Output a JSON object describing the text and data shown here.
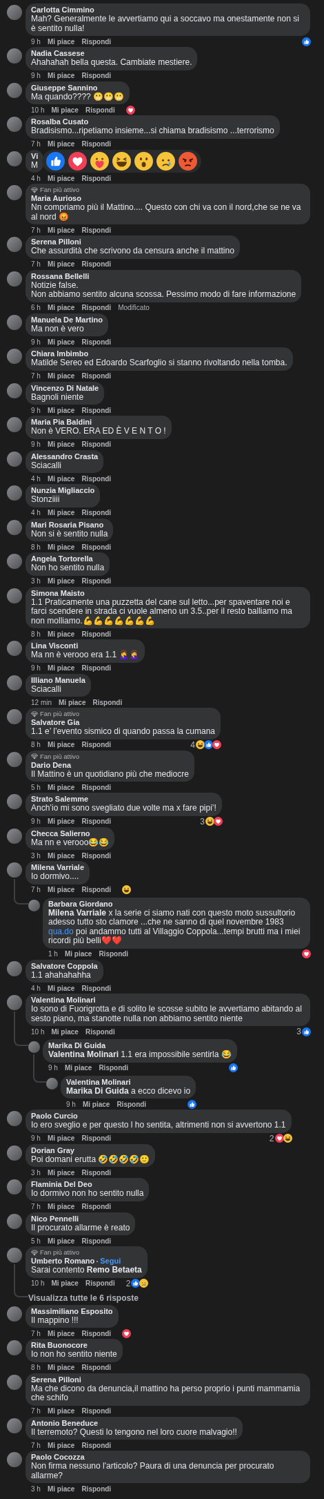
{
  "comments": [
    {
      "author": "Carlotta Cimmino",
      "text": "Mah? Generalmente le avvertiamo qui a soccavo ma onestamente non si è sentito nulla!",
      "time": "9 h",
      "like": "Mi piace",
      "reply": "Rispondi",
      "reactions": {
        "icons": [
          {
            "kind": "like"
          }
        ]
      }
    },
    {
      "author": "Nadia Cassese",
      "text": "Ahahahah bella questa. Cambiate mestiere.",
      "time": "9 h",
      "like": "Mi piace",
      "reply": "Rispondi"
    },
    {
      "author": "Giuseppe Sannino",
      "text": "Ma quando???? 😬😬😬",
      "time": "10 h",
      "like": "Mi piace",
      "reply": "Rispondi",
      "reactions": {
        "icons": [
          {
            "kind": "love"
          }
        ]
      }
    },
    {
      "author": "Rosalba Cusato",
      "text": "Bradisismo...ripetiamo insieme...si chiama bradisismo ...terrorismo",
      "time": "7 h",
      "like": "Mi piace",
      "reply": "Rispondi"
    },
    {
      "author": "Vi",
      "text": "M",
      "time": "4 h",
      "like": "Mi piace",
      "reply": "Rispondi",
      "reaction_picker": [
        {
          "kind": "like"
        },
        {
          "kind": "love"
        },
        {
          "kind": "care"
        },
        {
          "kind": "haha"
        },
        {
          "kind": "wow"
        },
        {
          "kind": "sad"
        },
        {
          "kind": "angry"
        }
      ]
    },
    {
      "badge": "Fan più attivo",
      "author": "Maria Aurioso",
      "text": "Nn compriamo più il Mattino.... Questo con chi va con il nord,che se ne va al nord 😡",
      "time": "7 h",
      "like": "Mi piace",
      "reply": "Rispondi"
    },
    {
      "author": "Serena Pilloni",
      "text": "Che assurdità che scrivono da censura anche il mattino",
      "time": "7 h",
      "like": "Mi piace",
      "reply": "Rispondi"
    },
    {
      "author": "Rossana Bellelli",
      "text": "Notizie false.\nNon abbiamo sentito alcuna scossa. Pessimo modo di fare informazione",
      "time": "6 h",
      "like": "Mi piace",
      "reply": "Rispondi",
      "edited": "Modificato"
    },
    {
      "author": "Manuela De Martino",
      "text": "Ma non è vero",
      "time": "9 h",
      "like": "Mi piace",
      "reply": "Rispondi"
    },
    {
      "author": "Chiara Imbimbo",
      "text": "Matilde Sereo ed Edoardo Scarfoglio si stanno rivoltando nella tomba.",
      "time": "7 h",
      "like": "Mi piace",
      "reply": "Rispondi"
    },
    {
      "author": "Vincenzo Di Natale",
      "text": "Bagnoli niente",
      "time": "9 h",
      "like": "Mi piace",
      "reply": "Rispondi"
    },
    {
      "author": "Maria Pia Baldini",
      "text": "Non è VERO. ERA ED È V E N T O !",
      "time": "9 h",
      "like": "Mi piace",
      "reply": "Rispondi"
    },
    {
      "author": "Alessandro Crasta",
      "text": "Sciacalli",
      "time": "4 h",
      "like": "Mi piace",
      "reply": "Rispondi"
    },
    {
      "author": "Nunzia Migliaccio",
      "text": "Stonziiii",
      "time": "4 h",
      "like": "Mi piace",
      "reply": "Rispondi"
    },
    {
      "author": "Mari Rosaria Pisano",
      "text": "Non si è sentito nulla",
      "time": "8 h",
      "like": "Mi piace",
      "reply": "Rispondi"
    },
    {
      "author": "Angela Tortorella",
      "text": "Non ho sentito nulla",
      "time": "3 h",
      "like": "Mi piace",
      "reply": "Rispondi"
    },
    {
      "author": "Simona Maisto",
      "text": "1.1 Praticamente una puzzetta del cane sul letto...per spaventare noi e farci scendere in strada ci vuole almeno un 3.5..per il resto balliamo ma non molliamo.💪💪💪💪💪💪💪",
      "time": "8 h",
      "like": "Mi piace",
      "reply": "Rispondi"
    },
    {
      "author": "Lina Visconti",
      "text": "Ma nn è verooo era 1.1 🤦‍♀️🤦‍♀️",
      "time": "9 h",
      "like": "Mi piace",
      "reply": "Rispondi"
    },
    {
      "author": "Illiano Manuela",
      "text": "Sciacalli",
      "time": "12 min",
      "like": "Mi piace",
      "reply": "Rispondi"
    },
    {
      "badge": "Fan più attivo",
      "author": "Salvatore Gia",
      "text": "1.1 e’ l’evento sismico di quando passa la cumana",
      "time": "8 h",
      "like": "Mi piace",
      "reply": "Rispondi",
      "reactions": {
        "count": "4",
        "icons": [
          {
            "kind": "haha"
          },
          {
            "kind": "like"
          },
          {
            "kind": "love"
          }
        ]
      }
    },
    {
      "badge": "Fan più attivo",
      "author": "Dario Dena",
      "text": "Il Mattino è un quotidiano più che mediocre",
      "time": "5 h",
      "like": "Mi piace",
      "reply": "Rispondi"
    },
    {
      "author": "Strato Salemme",
      "text": "Anch’io mi sono svegliato due volte ma x fare pipi’!",
      "time": "9 h",
      "like": "Mi piace",
      "reply": "Rispondi",
      "reactions": {
        "count": "3",
        "icons": [
          {
            "kind": "haha"
          },
          {
            "kind": "love"
          }
        ]
      }
    },
    {
      "author": "Checca Salierno",
      "text": "Ma nn e verooo😂😂",
      "time": "3 h",
      "like": "Mi piace",
      "reply": "Rispondi"
    },
    {
      "author": "Milena Varriale",
      "text": "Io dormivo....",
      "time": "7 h",
      "like": "Mi piace",
      "reply": "Rispondi",
      "reactions": {
        "icons": [
          {
            "kind": "haha"
          }
        ]
      },
      "replies": [
        {
          "author": "Barbara Giordano",
          "text": [
            {
              "kind": "text",
              "s": "**Milena Varriale** x la serie ci siamo nati con questo moto sussultorio adesso tutto sto clamore ...che ne sanno di quel novembre 1983 "
            },
            {
              "kind": "link",
              "s": "qua.do"
            },
            {
              "kind": "text",
              "s": " poi andammo tutti al Villaggio Coppola...tempi brutti ma i miei ricordi più belli❤️❤️"
            }
          ],
          "time": "1 h",
          "like": "Mi piace",
          "reply": "Rispondi",
          "reactions": {
            "icons": [
              {
                "kind": "love"
              }
            ]
          }
        }
      ]
    },
    {
      "author": "Salvatore Coppola",
      "text": "1.1 ahahahahha",
      "time": "4 h",
      "like": "Mi piace",
      "reply": "Rispondi"
    },
    {
      "author": "Valentina Molinari",
      "text": "Io sono di Fuorigrotta e di solito le scosse subito le avvertiamo abitando al sesto piano, ma stanotte nulla non abbiamo sentito niente",
      "time": "10 h",
      "like": "Mi piace",
      "reply": "Rispondi",
      "reactions": {
        "count": "3",
        "icons": [
          {
            "kind": "like"
          }
        ]
      },
      "replies": [
        {
          "author": "Marika Di Guida",
          "text": "**Valentina Molinari** 1.1 era impossibile sentirla 😂",
          "time": "9 h",
          "like": "Mi piace",
          "reply": "Rispondi",
          "reactions": {
            "icons": [
              {
                "kind": "like"
              }
            ]
          },
          "replies": [
            {
              "author": "Valentina Molinari",
              "text": "**Marika Di Guida** a ecco dicevo io",
              "time": "9 h",
              "like": "Mi piace",
              "reply": "Rispondi",
              "reactions": {
                "icons": [
                  {
                    "kind": "like"
                  }
                ]
              }
            }
          ]
        }
      ]
    },
    {
      "author": "Paolo Curcio",
      "text": "Io ero sveglio e per questo l ho sentita, altrimenti non si avvertono 1.1",
      "time": "9 h",
      "like": "Mi piace",
      "reply": "Rispondi",
      "reactions": {
        "count": "2",
        "icons": [
          {
            "kind": "love"
          },
          {
            "kind": "haha"
          }
        ]
      }
    },
    {
      "author": "Dorian Gray",
      "text": "Poi domani erutta 🤣🤣🤣🤣🙂",
      "time": "3 h",
      "like": "Mi piace",
      "reply": "Rispondi"
    },
    {
      "author": "Flaminia Del Deo",
      "text": "Io dormivo non ho sentito nulla",
      "time": "7 h",
      "like": "Mi piace",
      "reply": "Rispondi"
    },
    {
      "author": "Nico Pennelli",
      "text": "Il procurato allarme è reato",
      "time": "5 h",
      "like": "Mi piace",
      "reply": "Rispondi"
    },
    {
      "badge": "Fan più attivo",
      "author": "Umberto Romano",
      "follow": "Segui",
      "text": "Sarai contento **Remo Betaeta**",
      "time": "10 h",
      "like": "Mi piace",
      "reply": "Rispondi",
      "reactions": {
        "count": "2",
        "icons": [
          {
            "kind": "like"
          },
          {
            "kind": "sad"
          }
        ]
      },
      "more_replies": "Visualizza tutte le 6 risposte"
    },
    {
      "author": "Massimiliano Esposito",
      "text": "Il mappino !!!",
      "time": "7 h",
      "like": "Mi piace",
      "reply": "Rispondi",
      "reactions": {
        "icons": [
          {
            "kind": "love"
          }
        ]
      }
    },
    {
      "author": "Rita Buonocore",
      "text": "Io non ho sentito niente",
      "time": "8 h",
      "like": "Mi piace",
      "reply": "Rispondi"
    },
    {
      "author": "Serena Pilloni",
      "text": "Ma che dicono da denuncia,il mattino ha perso proprio i punti mammamia che schifo",
      "time": "7 h",
      "like": "Mi piace",
      "reply": "Rispondi"
    },
    {
      "author": "Antonio Beneduce",
      "text": "Il terremoto? Questi lo tengono nel loro cuore malvagio!!",
      "time": "7 h",
      "like": "Mi piace",
      "reply": "Rispondi"
    },
    {
      "author": "Paolo Cocozza",
      "text": "Non firma nessuno l'articolo? Paura di una denuncia per procurato allarme?",
      "time": "3 h",
      "like": "Mi piace",
      "reply": "Rispondi"
    }
  ]
}
